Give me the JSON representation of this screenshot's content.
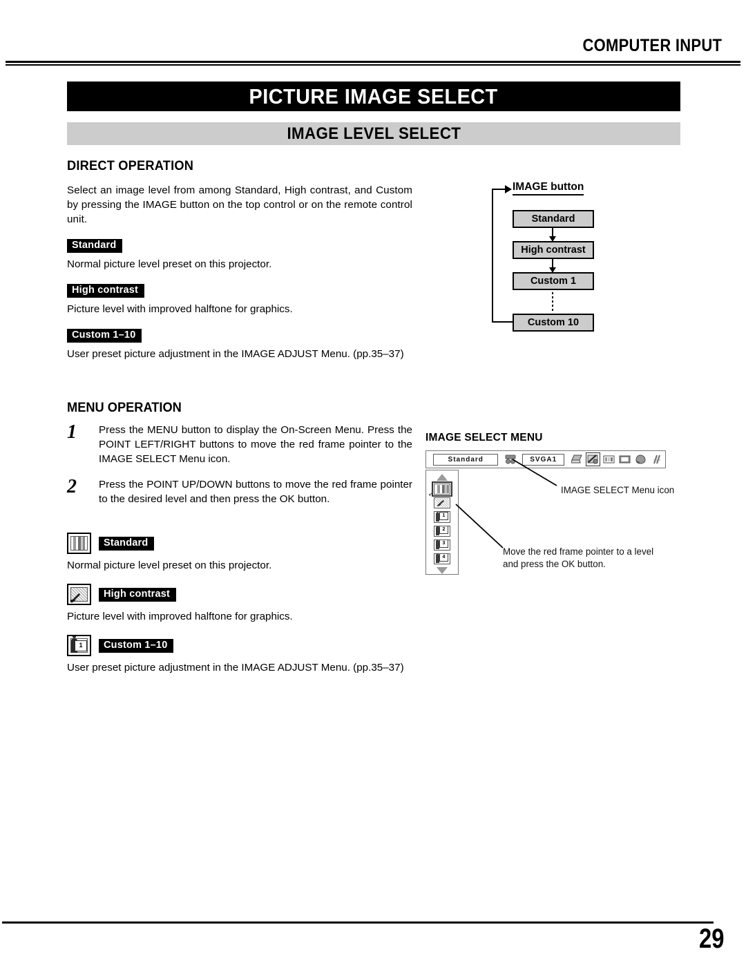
{
  "header": {
    "title": "COMPUTER INPUT"
  },
  "banners": {
    "main_title": "PICTURE IMAGE SELECT",
    "section_title": "IMAGE LEVEL SELECT"
  },
  "direct_operation": {
    "heading": "DIRECT OPERATION",
    "intro": "Select an image level from among Standard, High contrast, and Custom by pressing the IMAGE button on the top control or on the remote control unit.",
    "levels": [
      {
        "tag": "Standard",
        "description": "Normal picture level preset on this projector."
      },
      {
        "tag": "High contrast",
        "description": "Picture level with improved halftone for graphics."
      },
      {
        "tag": "Custom 1–10",
        "description": "User preset picture adjustment in the IMAGE ADJUST Menu. (pp.35–37)"
      }
    ]
  },
  "image_button_flow": {
    "title": "IMAGE button",
    "steps": [
      "Standard",
      "High contrast",
      "Custom 1",
      "Custom 10"
    ],
    "box_fill": "#cccccc"
  },
  "menu_operation": {
    "heading": "MENU OPERATION",
    "steps": [
      {
        "number": "1",
        "text": "Press the MENU button to display the On-Screen Menu. Press the POINT LEFT/RIGHT buttons to move the red frame pointer to the IMAGE SELECT Menu icon."
      },
      {
        "number": "2",
        "text": "Press the POINT UP/DOWN buttons to move the red frame pointer to the desired level and then press the OK button."
      }
    ],
    "levels": [
      {
        "icon": "gradient-bars-icon",
        "tag": "Standard",
        "description": "Normal picture level preset on this projector."
      },
      {
        "icon": "hand-brush-icon",
        "tag": "High contrast",
        "description": "Picture level with improved halftone for graphics."
      },
      {
        "icon": "person-panel-icon",
        "tag": "Custom 1–10",
        "description": "User preset picture adjustment in the IMAGE ADJUST Menu. (pp.35–37)"
      }
    ]
  },
  "osd": {
    "title": "IMAGE SELECT MENU",
    "level_field": "Standard",
    "input_field": "SVGA1",
    "menu_icons": [
      "computer-icon",
      "image-select-icon",
      "image-adjust-icon",
      "screen-icon",
      "sound-icon",
      "setting-icon"
    ],
    "selected_menu_icon": "image-select-icon",
    "panel_items": [
      {
        "icon": "gradient-bars-icon",
        "label": "",
        "selected": true
      },
      {
        "icon": "hand-brush-icon",
        "label": "",
        "selected": false
      },
      {
        "icon": "person-panel-icon",
        "label": "1",
        "selected": false
      },
      {
        "icon": "person-panel-icon",
        "label": "2",
        "selected": false
      },
      {
        "icon": "person-panel-icon",
        "label": "3",
        "selected": false
      },
      {
        "icon": "person-panel-icon",
        "label": "4",
        "selected": false
      }
    ],
    "callout_icon": "IMAGE SELECT Menu icon",
    "callout_pointer": "Move the red frame pointer to a level and press the OK button."
  },
  "footer": {
    "page_number": "29"
  }
}
